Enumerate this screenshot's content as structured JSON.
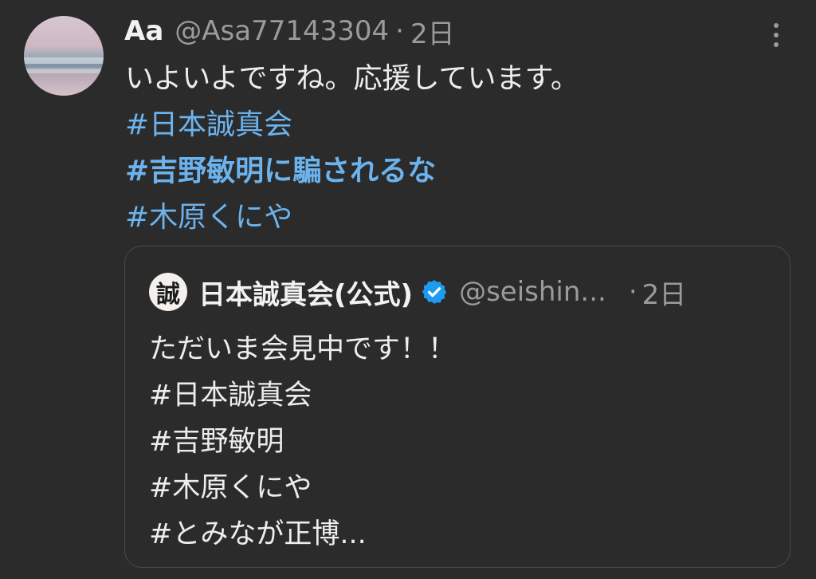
{
  "tweet": {
    "display_name": "Aa",
    "handle": "@Asa77143304",
    "separator": "·",
    "time": "2日",
    "text_line1": "いよいよですね。応援しています。",
    "hashtags": [
      "#日本誠真会",
      "#吉野敏明に騙されるな",
      "#木原くにや"
    ]
  },
  "quoted": {
    "avatar_char": "誠",
    "display_name": "日本誠真会(公式)",
    "handle": "@seishin...",
    "separator": "·",
    "time": "2日",
    "lines": [
      "ただいま会見中です！！",
      "#日本誠真会",
      "#吉野敏明",
      "#木原くにや",
      "#とみなが正博..."
    ]
  },
  "icons": {
    "more": "more-vertical-icon",
    "verified": "verified-badge-icon"
  },
  "colors": {
    "background": "#2b2b2b",
    "hashtag": "#6cb3ee",
    "secondary_text": "#9b9b9b",
    "verified": "#1d9bf0"
  }
}
